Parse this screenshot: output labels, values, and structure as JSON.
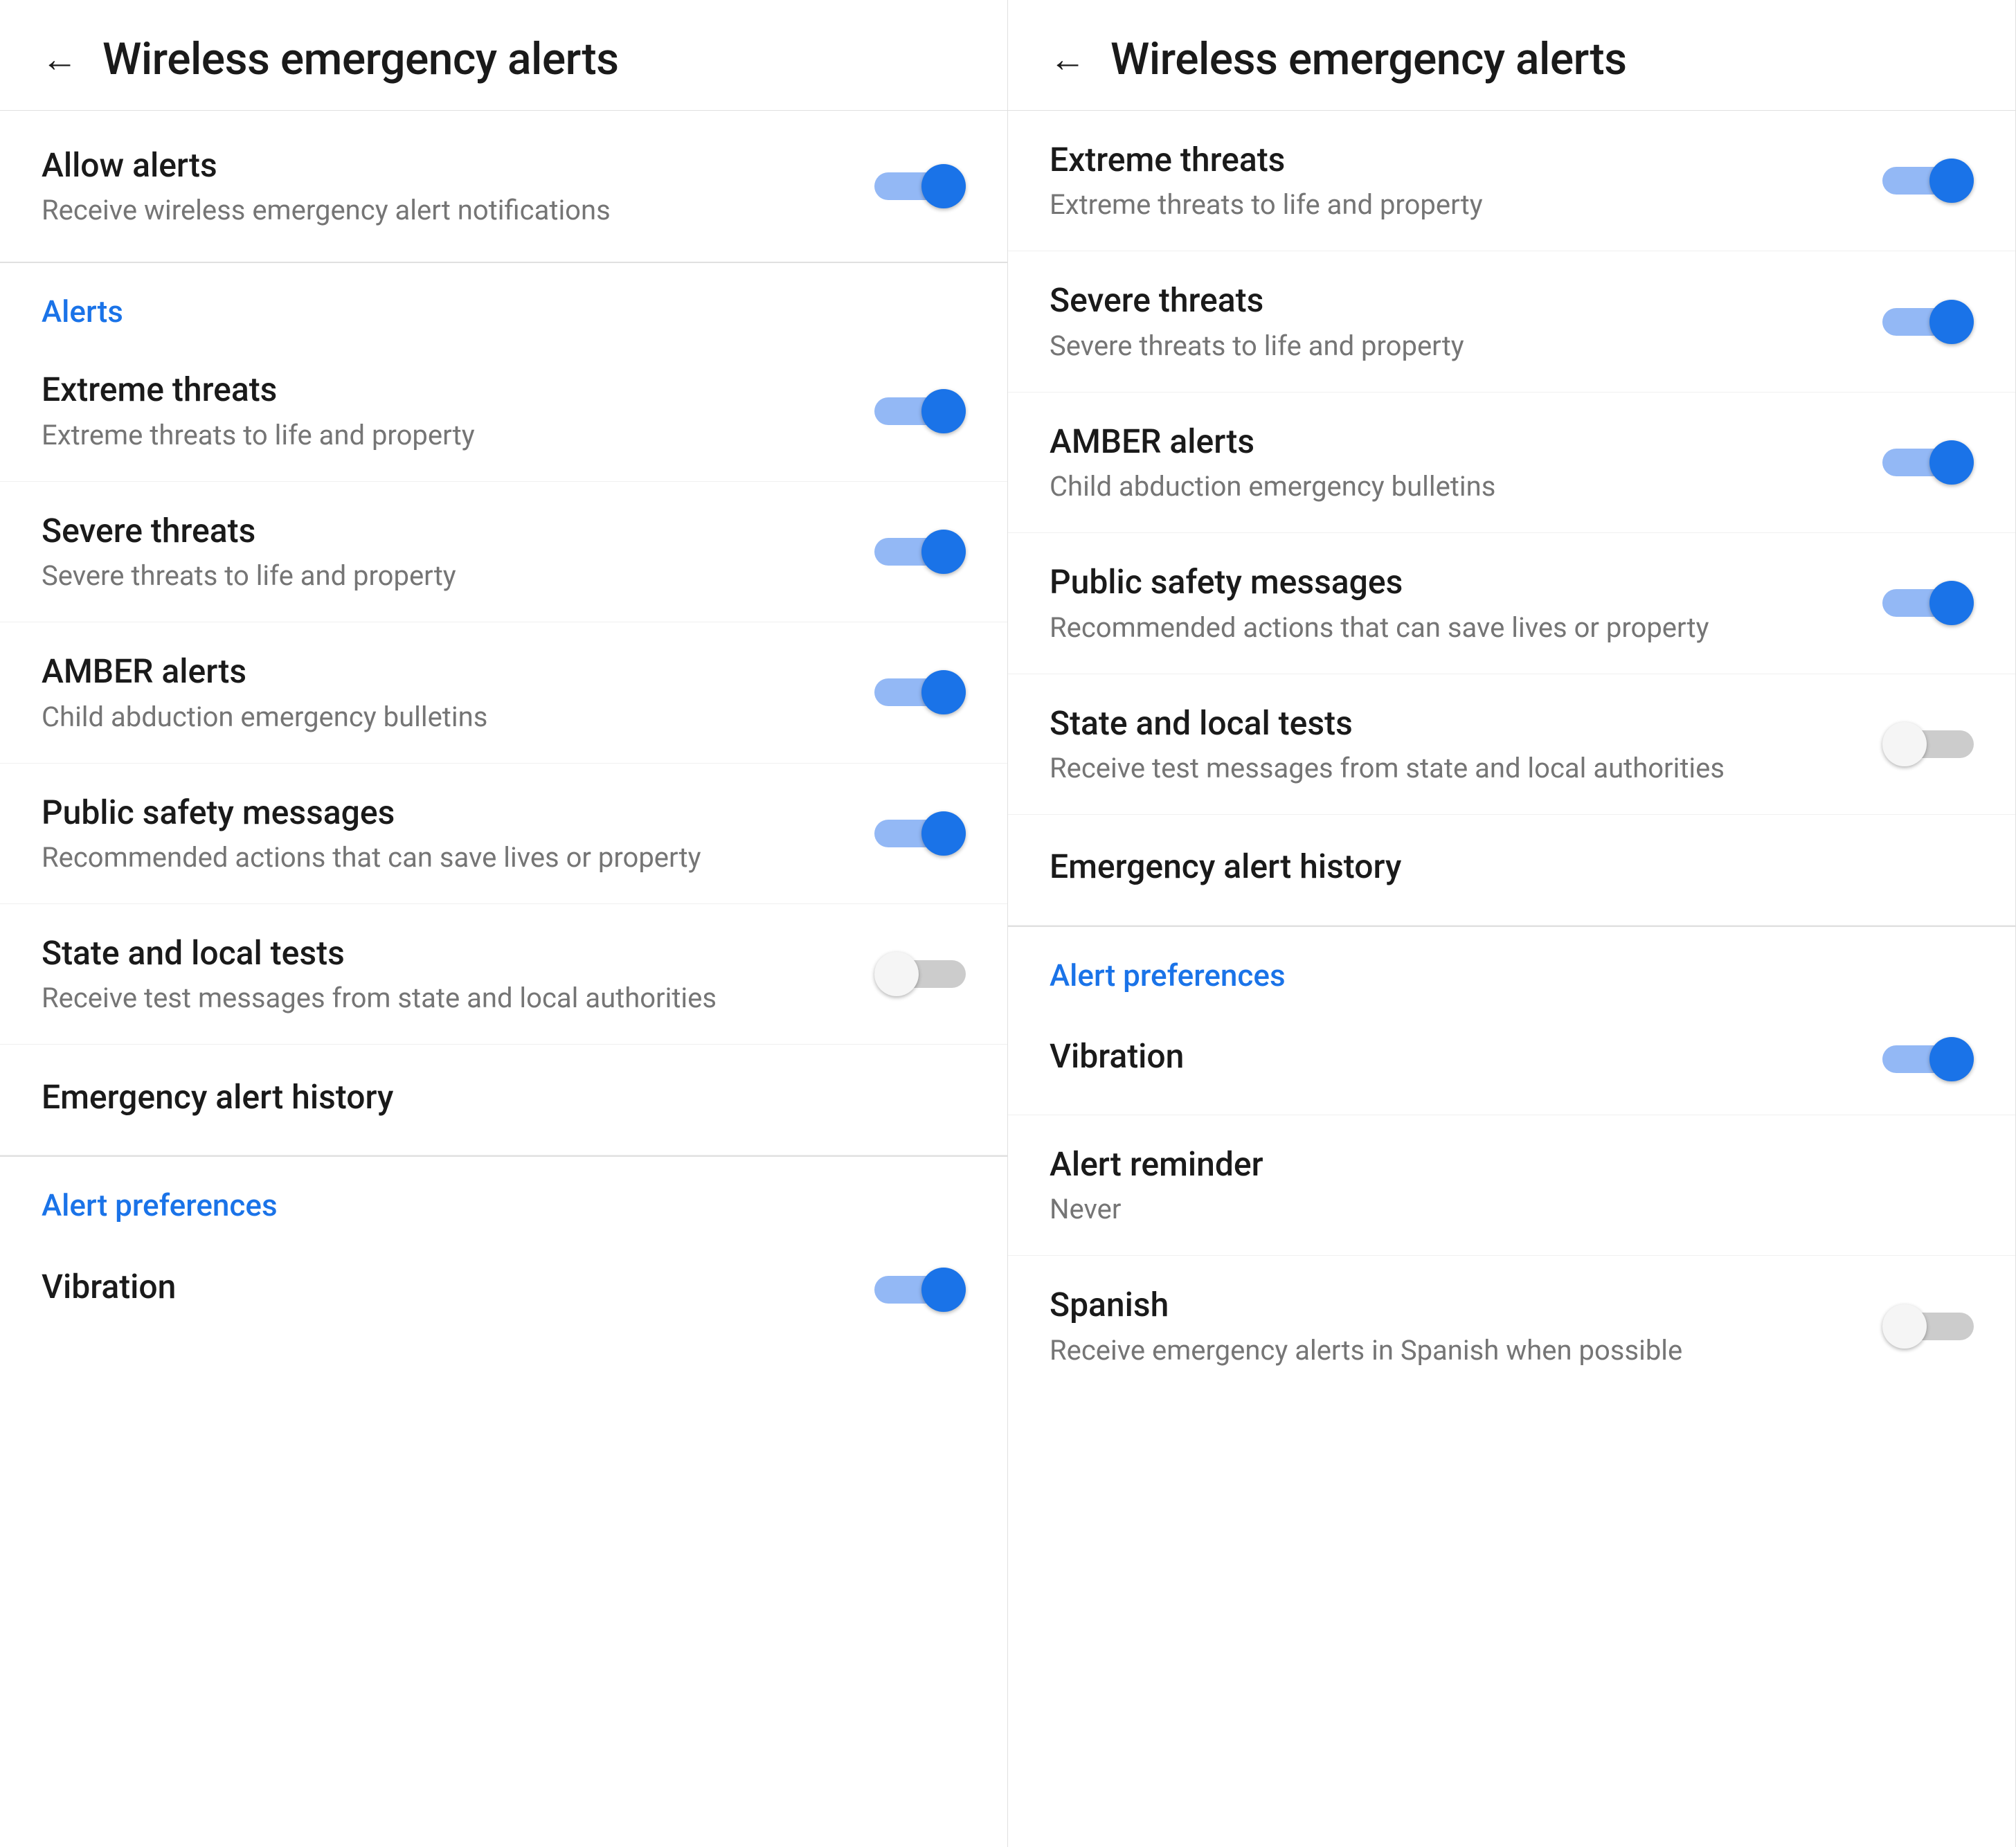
{
  "left_panel": {
    "header": {
      "back_label": "←",
      "title": "Wireless emergency alerts"
    },
    "top_section": {
      "title": "Allow alerts",
      "subtitle": "Receive wireless emergency alert notifications",
      "toggle": "on"
    },
    "alerts_section": {
      "label": "Alerts",
      "items": [
        {
          "title": "Extreme threats",
          "subtitle": "Extreme threats to life and property",
          "toggle": "on"
        },
        {
          "title": "Severe threats",
          "subtitle": "Severe threats to life and property",
          "toggle": "on"
        },
        {
          "title": "AMBER alerts",
          "subtitle": "Child abduction emergency bulletins",
          "toggle": "on"
        },
        {
          "title": "Public safety messages",
          "subtitle": "Recommended actions that can save lives or property",
          "toggle": "on"
        },
        {
          "title": "State and local tests",
          "subtitle": "Receive test messages from state and local authorities",
          "toggle": "off"
        },
        {
          "title": "Emergency alert history",
          "subtitle": "",
          "toggle": "none"
        }
      ]
    },
    "preferences_section": {
      "label": "Alert preferences",
      "items": [
        {
          "title": "Vibration",
          "subtitle": "",
          "toggle": "on"
        }
      ]
    }
  },
  "right_panel": {
    "header": {
      "back_label": "←",
      "title": "Wireless emergency alerts"
    },
    "alerts_section": {
      "items": [
        {
          "title": "Extreme threats",
          "subtitle": "Extreme threats to life and property",
          "toggle": "on"
        },
        {
          "title": "Severe threats",
          "subtitle": "Severe threats to life and property",
          "toggle": "on"
        },
        {
          "title": "AMBER alerts",
          "subtitle": "Child abduction emergency bulletins",
          "toggle": "on"
        },
        {
          "title": "Public safety messages",
          "subtitle": "Recommended actions that can save lives or property",
          "toggle": "on"
        },
        {
          "title": "State and local tests",
          "subtitle": "Receive test messages from state and local authorities",
          "toggle": "off"
        },
        {
          "title": "Emergency alert history",
          "subtitle": "",
          "toggle": "none"
        }
      ]
    },
    "preferences_section": {
      "label": "Alert preferences",
      "items": [
        {
          "title": "Vibration",
          "subtitle": "",
          "toggle": "on"
        },
        {
          "title": "Alert reminder",
          "subtitle": "Never",
          "toggle": "none"
        },
        {
          "title": "Spanish",
          "subtitle": "Receive emergency alerts in Spanish when possible",
          "toggle": "off"
        }
      ]
    }
  }
}
